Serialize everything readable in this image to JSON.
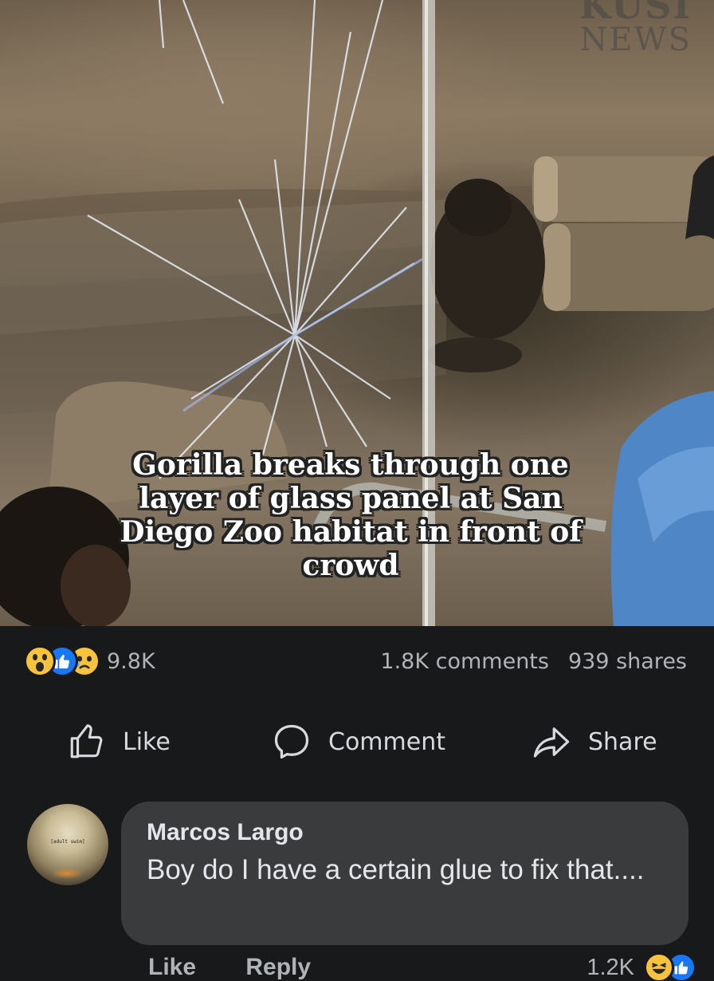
{
  "media": {
    "watermark_top": "KUSI",
    "watermark_bottom": "NEWS",
    "caption": "Gorilla breaks through one layer of glass panel at San Diego Zoo habitat in front of crowd"
  },
  "stats": {
    "reactions": [
      "wow-icon",
      "like-icon",
      "sad-icon"
    ],
    "reaction_count": "9.8K",
    "comments": "1.8K comments",
    "shares": "939 shares"
  },
  "actions": {
    "like": "Like",
    "comment": "Comment",
    "share": "Share"
  },
  "comment": {
    "avatar_text": "[adult swim]",
    "author": "Marcos Largo",
    "text": "Boy do I have a certain glue to fix that....",
    "like": "Like",
    "reply": "Reply",
    "reaction_count": "1.2K",
    "reactions": [
      "haha-icon",
      "like-icon"
    ]
  },
  "colors": {
    "background": "#18191a",
    "bubble": "#3a3b3c",
    "like_blue": "#1877f2",
    "emoji_yellow": "#f7c33c",
    "secondary_text": "#b0b3b8"
  }
}
